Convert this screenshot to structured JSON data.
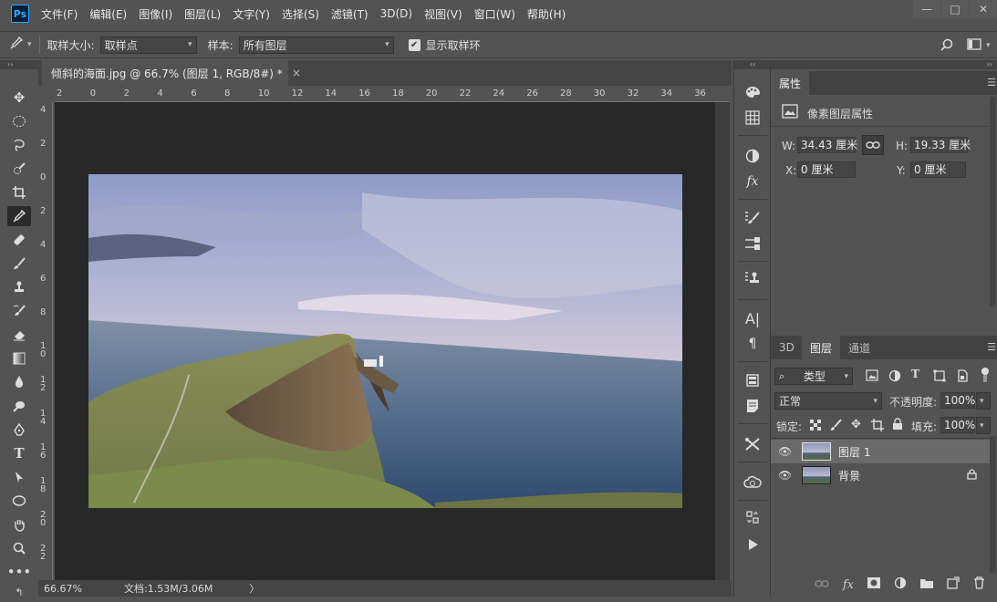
{
  "app": {
    "logo": "Ps"
  },
  "menu": [
    "文件(F)",
    "编辑(E)",
    "图像(I)",
    "图层(L)",
    "文字(Y)",
    "选择(S)",
    "滤镜(T)",
    "3D(D)",
    "视图(V)",
    "窗口(W)",
    "帮助(H)"
  ],
  "window_controls": {
    "minimize": "—",
    "maximize": "□",
    "close": "✕"
  },
  "options": {
    "sample_size_label": "取样大小:",
    "sample_size_value": "取样点",
    "sample_label": "样本:",
    "sample_value": "所有图层",
    "show_ring_label": "显示取样环",
    "show_ring_checked": true
  },
  "document": {
    "tab_title": "倾斜的海面.jpg @ 66.7% (图层 1, RGB/8#) *",
    "tab_close": "×",
    "ruler_top": [
      "2",
      "0",
      "2",
      "4",
      "6",
      "8",
      "10",
      "12",
      "14",
      "16",
      "18",
      "20",
      "22",
      "24",
      "26",
      "28",
      "30",
      "32",
      "34",
      "36"
    ],
    "ruler_left": [
      "4",
      "2",
      "0",
      "2",
      "4",
      "6",
      "8",
      "1 0",
      "1 2",
      "1 4",
      "1 6",
      "1 8",
      "2 0",
      "2 2"
    ],
    "zoom": "66.67%",
    "doc_info": "文档:1.53M/3.06M",
    "status_arrow": "〉"
  },
  "properties": {
    "tab_label": "属性",
    "title": "像素图层属性",
    "w_label": "W:",
    "w_value": "34.43 厘米",
    "h_label": "H:",
    "h_value": "19.33 厘米",
    "x_label": "X:",
    "x_value": "0 厘米",
    "y_label": "Y:",
    "y_value": "0 厘米"
  },
  "layers_panel": {
    "tabs": [
      "3D",
      "图层",
      "通道"
    ],
    "active_tab": "图层",
    "filter_kind": "类型",
    "blend_mode": "正常",
    "opacity_label": "不透明度:",
    "opacity_value": "100%",
    "lock_label": "锁定:",
    "fill_label": "填充:",
    "fill_value": "100%",
    "layers": [
      {
        "name": "图层 1",
        "selected": true,
        "locked": false
      },
      {
        "name": "背景",
        "selected": false,
        "locked": true
      }
    ]
  },
  "colors": {
    "bg": "#535353",
    "canvas": "#282828",
    "accent": "#31a8ff"
  }
}
